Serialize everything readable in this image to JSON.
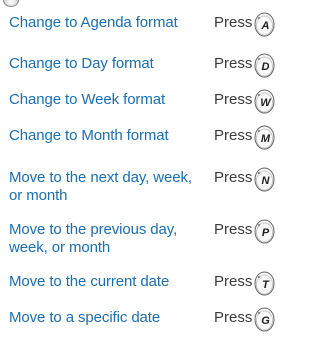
{
  "press_label": "Press",
  "rows": [
    {
      "label": "Change to Agenda format",
      "key": "A"
    },
    {
      "label": "Change to Day format",
      "key": "D"
    },
    {
      "label": "Change to Week format",
      "key": "W"
    },
    {
      "label": "Change to Month format",
      "key": "M"
    },
    {
      "label": "Move to the next day, week, or month",
      "key": "N"
    },
    {
      "label": "Move to the previous day, week, or month",
      "key": "P"
    },
    {
      "label": "Move to the current date",
      "key": "T"
    },
    {
      "label": "Move to a specific date",
      "key": "G"
    }
  ],
  "colors": {
    "text_blue": "#1a6fb0",
    "text_dark": "#3a3a3a"
  }
}
